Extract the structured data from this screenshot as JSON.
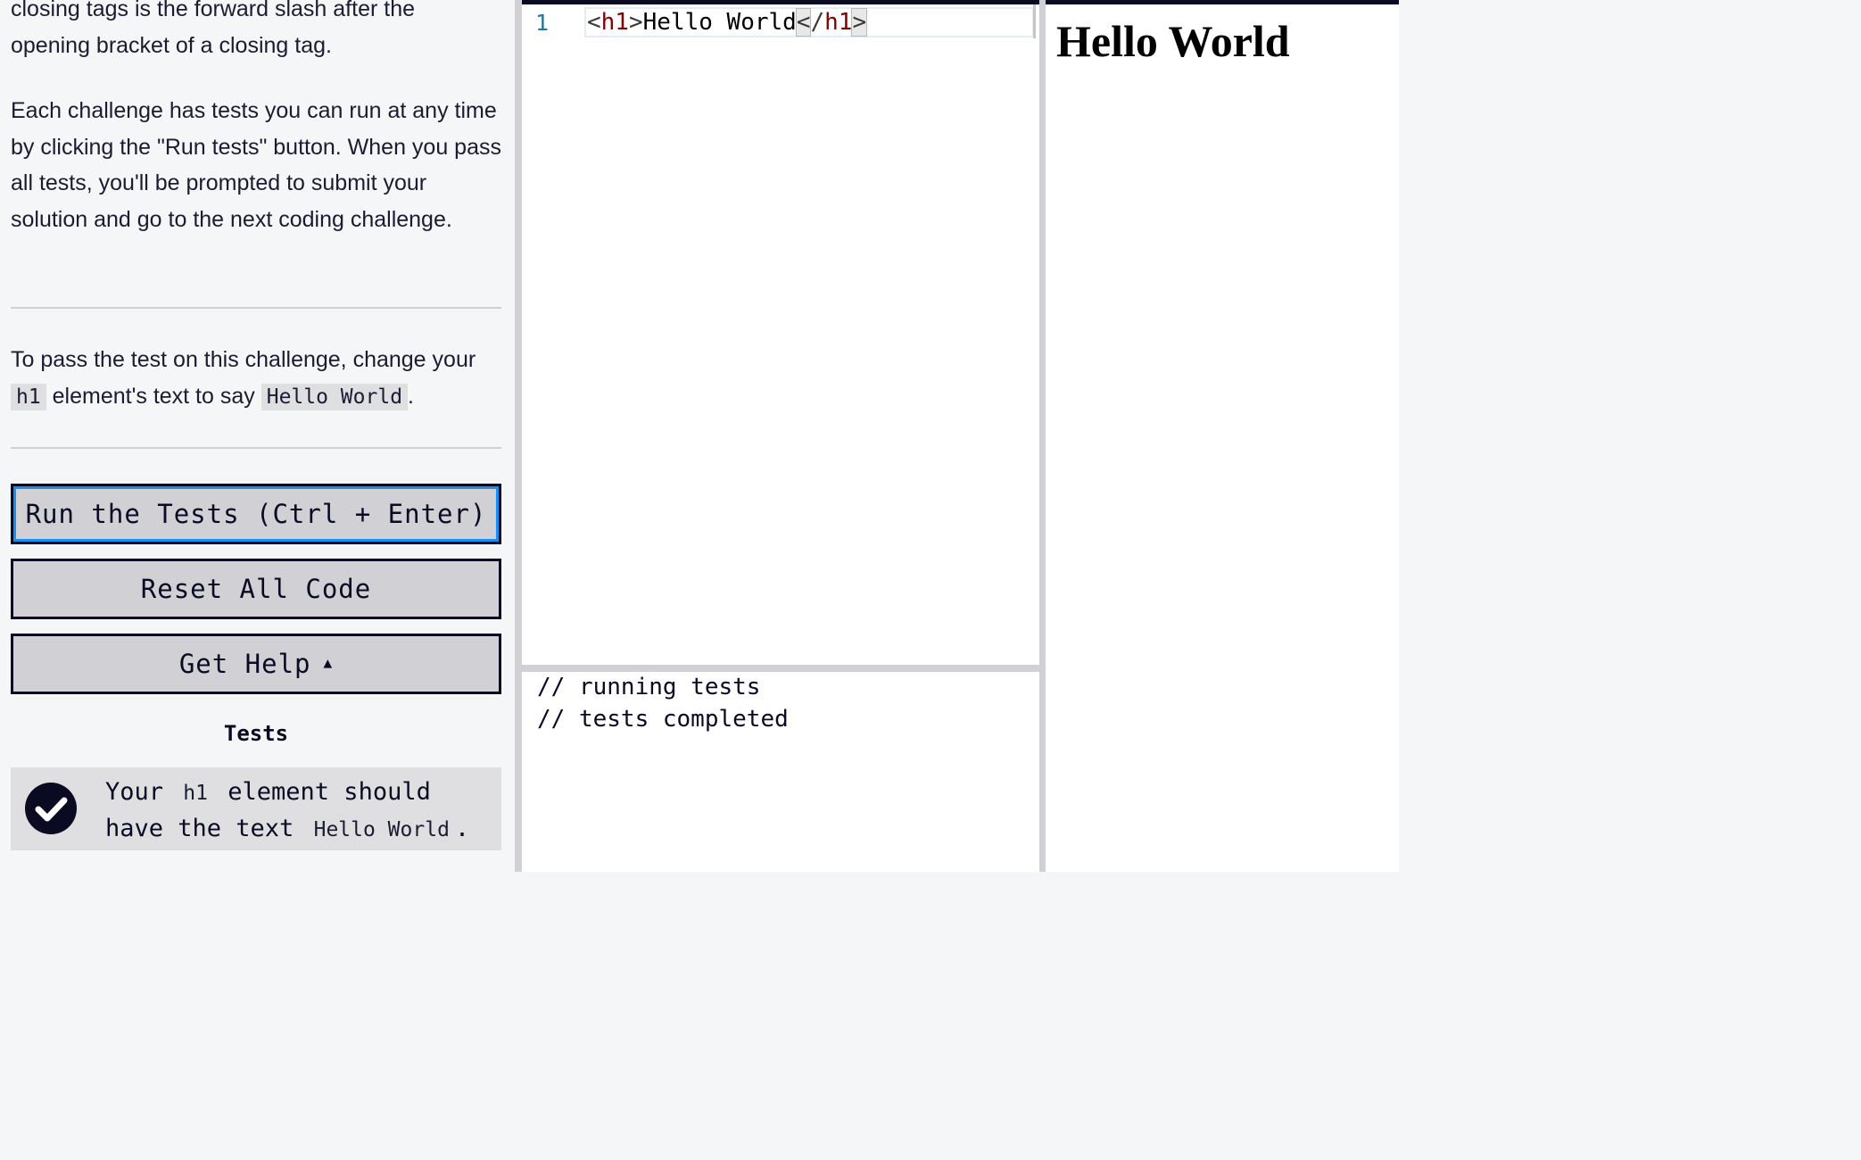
{
  "instructions": {
    "p1_line1": "closing tags is the forward slash after the",
    "p1_line2": "opening bracket of a closing tag.",
    "p2": "Each challenge has tests you can run at any time by clicking the \"Run tests\" button. When you pass all tests, you'll be prompted to submit your solution and go to the next coding challenge.",
    "p3_before": "To pass the test on this challenge, change your",
    "p3_code1": "h1",
    "p3_middle": "element's text to say",
    "p3_code2": "Hello World",
    "p3_after": "."
  },
  "buttons": {
    "run_tests": "Run the Tests (Ctrl + Enter)",
    "reset_code": "Reset All Code",
    "get_help": "Get Help"
  },
  "tests": {
    "title": "Tests",
    "items": [
      {
        "status": "passed",
        "text_before": "Your",
        "code1": "h1",
        "text_middle": "element should have the text",
        "code2": "Hello World",
        "text_after": "."
      }
    ]
  },
  "editor": {
    "line_number": "1",
    "open_lt": "<",
    "open_tag": "h1",
    "open_gt": ">",
    "content": "Hello World",
    "close_lt": "<",
    "close_slash": "/",
    "close_tag": "h1",
    "close_gt": ">"
  },
  "console": {
    "lines": [
      "// running tests",
      "// tests completed"
    ]
  },
  "preview": {
    "heading": "Hello World"
  },
  "colors": {
    "accent": "#198eee",
    "dark": "#0a0a23",
    "button_bg": "#d0d0d5",
    "tag_color": "#800000"
  },
  "icons": {
    "test_status": "check-circle-icon",
    "help_caret": "caret-up-icon"
  }
}
